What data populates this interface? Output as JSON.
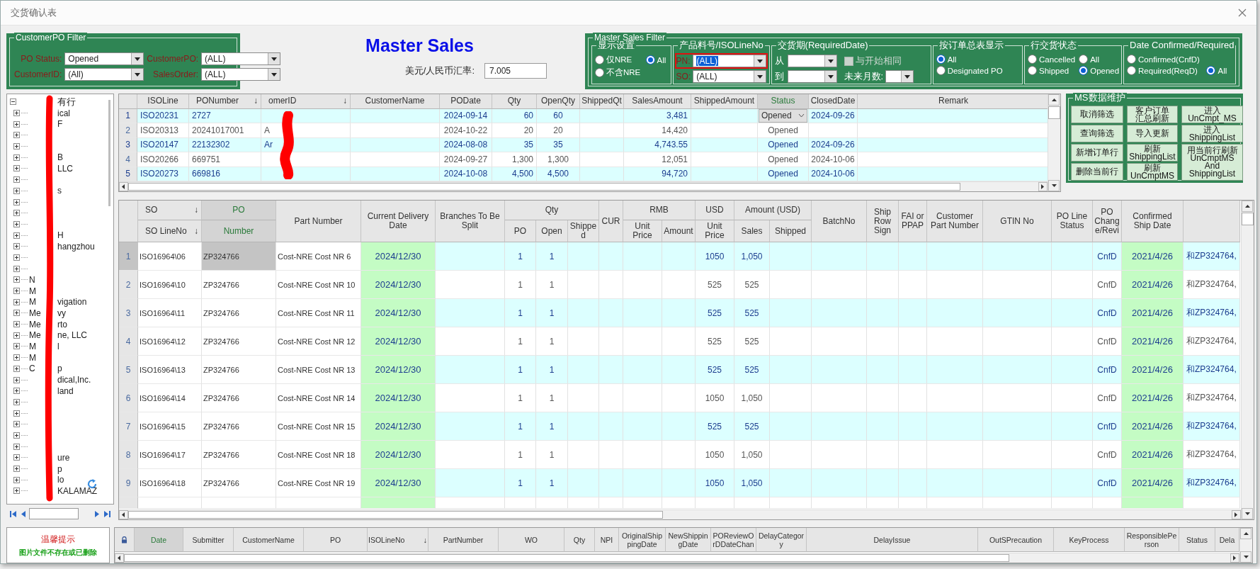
{
  "window": {
    "title": "交货确认表"
  },
  "customer_po_filter": {
    "title": "CustomerPO Filter",
    "fields": [
      {
        "label": "PO Status:",
        "value": "Opened"
      },
      {
        "label": "CustomerPO:",
        "value": "(ALL)"
      },
      {
        "label": "CustomerID:",
        "value": "(All)"
      },
      {
        "label": "SalesOrder:",
        "value": "(ALL)"
      }
    ]
  },
  "heading": "Master Sales",
  "exchange_rate": {
    "label": "美元/人民币汇率:",
    "value": "7.005"
  },
  "master_sales_filter": {
    "title": "Master Sales Filter",
    "groups": [
      {
        "kind": "radios",
        "title": "显示设置",
        "options": [
          {
            "label": "仅NRE",
            "selected": false
          },
          {
            "label": "All",
            "selected": true
          },
          {
            "label": "不含NRE",
            "selected": false
          }
        ]
      },
      {
        "kind": "combos",
        "title": "产品料号/ISOLineNo",
        "highlighted": true,
        "fields": [
          {
            "label": "PN:",
            "value": "(ALL)",
            "focused": true
          },
          {
            "label": "SO:",
            "value": "(ALL)",
            "focused": false
          }
        ]
      },
      {
        "kind": "dates",
        "title": "交货期(RequiredDate)",
        "from_label": "从",
        "to_label": "到",
        "same_as_start": {
          "label": "与开始相同",
          "checked": false,
          "disabled": true
        },
        "months_label": "未来月数:"
      },
      {
        "kind": "radios",
        "title": "按订单总表显示",
        "options": [
          {
            "label": "All",
            "selected": true
          },
          {
            "label": "Designated PO",
            "selected": false
          }
        ]
      },
      {
        "kind": "radios",
        "title": "行交货状态",
        "options": [
          {
            "label": "Cancelled",
            "selected": false
          },
          {
            "label": "All",
            "selected": false
          },
          {
            "label": "Shipped",
            "selected": false
          },
          {
            "label": "Opened",
            "selected": true
          }
        ]
      },
      {
        "kind": "radios",
        "title": "Date Confirmed/Required",
        "options": [
          {
            "label": "Confirmed(CnfD)",
            "selected": false
          },
          {
            "label": "Required(ReqD)",
            "selected": false
          },
          {
            "label": "All",
            "selected": true
          }
        ]
      }
    ]
  },
  "tree": {
    "items": [
      {
        "trailing": "有行",
        "expanded": true,
        "children": [
          {
            "expanded": false,
            "trailing": "ical"
          },
          {
            "expanded": false,
            "trailing": "F"
          },
          {
            "expanded": false
          },
          {
            "expanded": false
          },
          {
            "expanded": false,
            "trailing": "B"
          },
          {
            "expanded": false,
            "trailing": "LLC"
          },
          {
            "expanded": false
          },
          {
            "expanded": false,
            "trailing": "s"
          },
          {
            "expanded": false
          },
          {
            "expanded": false
          },
          {
            "expanded": false
          },
          {
            "expanded": false,
            "trailing": "H"
          },
          {
            "expanded": false,
            "trailing": "hangzhou"
          },
          {
            "expanded": false
          },
          {
            "expanded": false
          },
          {
            "expanded": false,
            "leading": "N"
          },
          {
            "expanded": false,
            "leading": "M"
          },
          {
            "expanded": false,
            "leading": "M",
            "trailing": "vigation"
          },
          {
            "expanded": false,
            "leading": "Me",
            "trailing": "vy"
          },
          {
            "expanded": false,
            "leading": "Me",
            "trailing": "rto"
          },
          {
            "expanded": false,
            "leading": "Me",
            "trailing": "ne, LLC"
          },
          {
            "expanded": false,
            "leading": "M",
            "trailing": "l"
          },
          {
            "expanded": false,
            "leading": "M"
          },
          {
            "expanded": false,
            "leading": "C",
            "trailing": "p"
          },
          {
            "expanded": false,
            "trailing": "dical,Inc."
          },
          {
            "expanded": false,
            "trailing": "land"
          },
          {
            "expanded": false
          },
          {
            "expanded": false
          },
          {
            "expanded": false
          },
          {
            "expanded": false
          },
          {
            "expanded": false
          },
          {
            "expanded": false,
            "trailing": "ure"
          },
          {
            "expanded": false,
            "trailing": "p"
          },
          {
            "expanded": false,
            "trailing": "lo"
          },
          {
            "expanded": false,
            "trailing": "KALAMAZ"
          }
        ]
      }
    ]
  },
  "top_grid": {
    "columns": [
      {
        "label": "ISOLine",
        "selected": false
      },
      {
        "label": "PONumber",
        "sort_icon": "↓",
        "selected": false
      },
      {
        "label": "omerID",
        "sort_icon": "↓",
        "selected": false
      },
      {
        "label": "CustomerName",
        "selected": false
      },
      {
        "label": "PODate",
        "selected": false
      },
      {
        "label": "Qty",
        "selected": false
      },
      {
        "label": "OpenQty",
        "selected": false
      },
      {
        "label": "ShippedQt",
        "selected": false
      },
      {
        "label": "SalesAmount",
        "selected": false
      },
      {
        "label": "ShippedAmount",
        "selected": false
      },
      {
        "label": "Status",
        "selected": true
      },
      {
        "label": "ClosedDate",
        "selected": false
      },
      {
        "label": "Remark",
        "selected": false
      }
    ],
    "rows": [
      {
        "num": "1",
        "highlighted": true,
        "selected": true,
        "cells": [
          "ISO20231",
          "2727",
          null,
          null,
          "2024-09-14",
          "60",
          "60",
          null,
          "3,481",
          null,
          "Opened",
          "2024-09-26",
          null
        ]
      },
      {
        "num": "2",
        "highlighted": false,
        "selected": false,
        "cells": [
          "ISO20313",
          "20241017001",
          "A",
          null,
          "2024-10-22",
          "20",
          "20",
          null,
          "14,420",
          null,
          "Opened",
          null,
          null
        ]
      },
      {
        "num": "3",
        "highlighted": true,
        "selected": false,
        "cells": [
          "ISO20147",
          "22132302",
          "Ar",
          null,
          "2024-08-08",
          "35",
          "35",
          null,
          "4,743.55",
          null,
          "Opened",
          "2024-09-26",
          null
        ]
      },
      {
        "num": "4",
        "highlighted": false,
        "selected": false,
        "cells": [
          "ISO20266",
          "669751",
          null,
          null,
          "2024-09-27",
          "1,300",
          "1,300",
          null,
          "12,051",
          null,
          "Opened",
          "2024-10-06",
          null
        ]
      },
      {
        "num": "5",
        "highlighted": true,
        "selected": false,
        "cells": [
          "ISO20273",
          "669816",
          null,
          null,
          "2024-10-08",
          "4,500",
          "4,500",
          null,
          "94,720",
          null,
          "Opened",
          "2024-10-06",
          null
        ]
      }
    ]
  },
  "ms_maintenance": {
    "title": "MS数据维护",
    "buttons": [
      "取消筛选",
      "查询筛选",
      "新增订单行",
      "删除当前行",
      "客户订单汇总刷新",
      "导入更新",
      "刷新\nShippingList",
      "刷新\nUnCmptMS",
      "进入\nUnCmpt_MS",
      "进入\nShippingList",
      "用当前行刷新\nUnCmptMS\nAnd\nShippingList"
    ]
  },
  "middle_grid": {
    "header_groups": [
      {
        "label": "SO",
        "sort_icon": "↓",
        "columns": [
          {
            "label": "SO LineNo",
            "sort_icon": "↓",
            "selected": false
          }
        ]
      },
      {
        "label": "PO",
        "columns": [
          {
            "label": "Number",
            "selected": true
          }
        ]
      },
      {
        "columns": [
          {
            "label": "Part Number",
            "selected": false
          }
        ]
      },
      {
        "columns": [
          {
            "label": "Current Delivery Date",
            "selected": false,
            "shaded": true
          }
        ]
      },
      {
        "columns": [
          {
            "label": "Branches To Be Split",
            "selected": false
          }
        ]
      },
      {
        "label": "Qty",
        "columns": [
          {
            "label": "PO",
            "selected": false
          },
          {
            "label": "Open",
            "selected": false
          },
          {
            "label": "Shipped",
            "selected": false
          }
        ]
      },
      {
        "columns": [
          {
            "label": "CUR",
            "selected": false
          }
        ]
      },
      {
        "label": "RMB",
        "columns": [
          {
            "label": "Unit Price",
            "selected": false
          },
          {
            "label": "Amount",
            "selected": false
          }
        ]
      },
      {
        "label": "USD",
        "columns": [
          {
            "label": "Unit Price",
            "selected": false
          }
        ]
      },
      {
        "label": "Amount (USD)",
        "columns": [
          {
            "label": "Sales",
            "selected": false
          },
          {
            "label": "Shipped",
            "selected": false
          }
        ]
      },
      {
        "columns": [
          {
            "label": "BatchNo",
            "selected": false
          }
        ]
      },
      {
        "columns": [
          {
            "label": "Ship Row Sign",
            "selected": false
          }
        ]
      },
      {
        "columns": [
          {
            "label": "FAI or PPAP",
            "selected": false
          }
        ]
      },
      {
        "columns": [
          {
            "label": "Customer Part Number",
            "selected": false
          }
        ]
      },
      {
        "columns": [
          {
            "label": "GTIN No",
            "selected": false
          }
        ]
      },
      {
        "columns": [
          {
            "label": "PO Line Status",
            "selected": false
          }
        ]
      },
      {
        "columns": [
          {
            "label": "PO Change/Revi",
            "selected": false
          }
        ]
      },
      {
        "columns": [
          {
            "label": "Confirmed Ship Date",
            "selected": false,
            "shaded": true
          }
        ]
      },
      {
        "columns": [
          {
            "selected": false
          }
        ]
      }
    ],
    "rows": [
      {
        "num": "1",
        "highlighted": true,
        "selected": true,
        "cells": [
          "ISO16964\\06",
          "ZP324766",
          "Cost-NRE Cost NR 6",
          "2024/12/30",
          null,
          "1",
          "1",
          null,
          null,
          null,
          null,
          "1050",
          "1,050",
          null,
          null,
          null,
          null,
          null,
          null,
          null,
          "CnfD",
          "2021/4/26",
          "和ZP324764,"
        ]
      },
      {
        "num": "2",
        "highlighted": false,
        "selected": false,
        "cells": [
          "ISO16964\\10",
          "ZP324766",
          "Cost-NRE Cost NR 10",
          "2024/12/30",
          null,
          "1",
          "1",
          null,
          null,
          null,
          null,
          "525",
          "525",
          null,
          null,
          null,
          null,
          null,
          null,
          null,
          "CnfD",
          "2021/4/26",
          "和ZP324764,"
        ]
      },
      {
        "num": "3",
        "highlighted": true,
        "selected": false,
        "cells": [
          "ISO16964\\11",
          "ZP324766",
          "Cost-NRE Cost NR 11",
          "2024/12/30",
          null,
          "1",
          "1",
          null,
          null,
          null,
          null,
          "525",
          "525",
          null,
          null,
          null,
          null,
          null,
          null,
          null,
          "CnfD",
          "2021/4/26",
          "和ZP324764,"
        ]
      },
      {
        "num": "4",
        "highlighted": false,
        "selected": false,
        "cells": [
          "ISO16964\\12",
          "ZP324766",
          "Cost-NRE Cost NR 12",
          "2024/12/30",
          null,
          "1",
          "1",
          null,
          null,
          null,
          null,
          "525",
          "525",
          null,
          null,
          null,
          null,
          null,
          null,
          null,
          "CnfD",
          "2021/4/26",
          "和ZP324764,"
        ]
      },
      {
        "num": "5",
        "highlighted": true,
        "selected": false,
        "cells": [
          "ISO16964\\13",
          "ZP324766",
          "Cost-NRE Cost NR 13",
          "2024/12/30",
          null,
          "1",
          "1",
          null,
          null,
          null,
          null,
          "525",
          "525",
          null,
          null,
          null,
          null,
          null,
          null,
          null,
          "CnfD",
          "2021/4/26",
          "和ZP324764,"
        ]
      },
      {
        "num": "6",
        "highlighted": false,
        "selected": false,
        "cells": [
          "ISO16964\\14",
          "ZP324766",
          "Cost-NRE Cost NR 14",
          "2024/12/30",
          null,
          "1",
          "1",
          null,
          null,
          null,
          null,
          "1050",
          "1,050",
          null,
          null,
          null,
          null,
          null,
          null,
          null,
          "CnfD",
          "2021/4/26",
          "和ZP324764,"
        ]
      },
      {
        "num": "7",
        "highlighted": true,
        "selected": false,
        "cells": [
          "ISO16964\\15",
          "ZP324766",
          "Cost-NRE Cost NR 15",
          "2024/12/30",
          null,
          "1",
          "1",
          null,
          null,
          null,
          null,
          "525",
          "525",
          null,
          null,
          null,
          null,
          null,
          null,
          null,
          "CnfD",
          "2021/4/26",
          "和ZP324764,"
        ]
      },
      {
        "num": "8",
        "highlighted": false,
        "selected": false,
        "cells": [
          "ISO16964\\17",
          "ZP324766",
          "Cost-NRE Cost NR 18",
          "2024/12/30",
          null,
          "1",
          "1",
          null,
          null,
          null,
          null,
          "1050",
          "1,050",
          null,
          null,
          null,
          null,
          null,
          null,
          null,
          "CnfD",
          "2021/4/26",
          "和ZP324764,"
        ]
      },
      {
        "num": "9",
        "highlighted": true,
        "selected": false,
        "cells": [
          "ISO16964\\18",
          "ZP324766",
          "Cost-NRE Cost NR 19",
          "2024/12/30",
          null,
          "1",
          "1",
          null,
          null,
          null,
          null,
          "1050",
          "1,050",
          null,
          null,
          null,
          null,
          null,
          null,
          null,
          "CnfD",
          "2021/4/26",
          "和ZP324764,"
        ]
      }
    ]
  },
  "logo": {
    "title": "温馨提示",
    "subtitle": "图片文件不存在或已删除"
  },
  "bottom_grid": {
    "columns": [
      {
        "label": "Date",
        "selected": true
      },
      {
        "label": "Submitter",
        "selected": false
      },
      {
        "label": "CustomerName",
        "selected": false
      },
      {
        "label": "PO",
        "selected": false
      },
      {
        "label": "ISOLineNo",
        "sort_icon": "↓",
        "selected": false
      },
      {
        "label": "PartNumber",
        "selected": false
      },
      {
        "label": "WO",
        "selected": false
      },
      {
        "label": "Qty",
        "selected": false
      },
      {
        "label": "NPI",
        "selected": false
      },
      {
        "label": "OriginalShippingDate",
        "selected": false
      },
      {
        "label": "NewShippingDate",
        "selected": false
      },
      {
        "label": "POReviewOrDDateChan",
        "selected": false
      },
      {
        "label": "DelayCategory",
        "selected": false
      },
      {
        "label": "DelayIssue",
        "selected": false
      },
      {
        "label": "OutSPrecaution",
        "selected": false
      },
      {
        "label": "KeyProcess",
        "selected": false
      },
      {
        "label": "ResponsiblePerson",
        "selected": false
      },
      {
        "label": "Status",
        "selected": false
      },
      {
        "label": "Dela",
        "selected": false
      }
    ]
  }
}
